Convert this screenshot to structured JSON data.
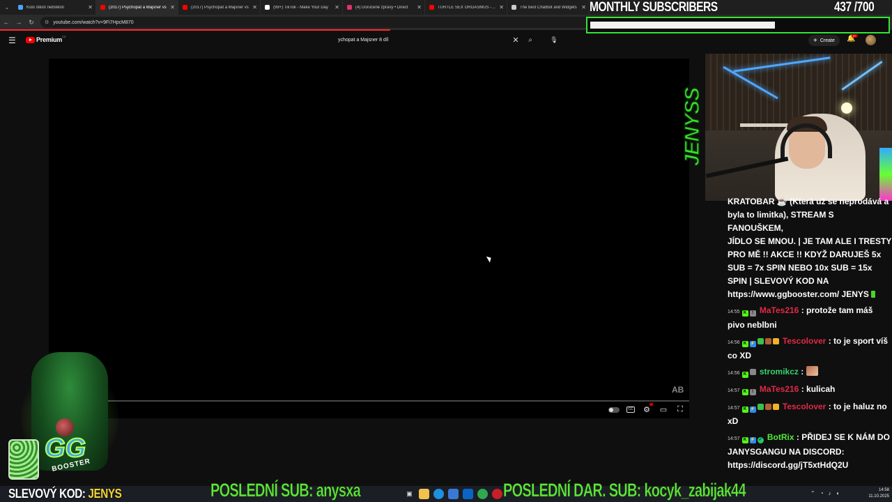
{
  "browser": {
    "tabs": [
      {
        "title": "Kolo štěstí nebštěstí",
        "favicon_color": "#4aa3ff",
        "active": false
      },
      {
        "title": "(2017) Psychopat a Majsner vs",
        "favicon_color": "#ff0000",
        "active": true
      },
      {
        "title": "(2017) Psychopat a Majsner vs",
        "favicon_color": "#ff0000",
        "active": false
      },
      {
        "title": "(99+) TikTok - Make Your Day",
        "favicon_color": "#ffffff",
        "active": false
      },
      {
        "title": "(4) Doručené zprávy • Direct",
        "favicon_color": "#e1306c",
        "active": false
      },
      {
        "title": "TURTLE SEX ORGASMUS - YouTube",
        "favicon_color": "#ff0000",
        "active": false
      },
      {
        "title": "The best ChatBot and Widgets",
        "favicon_color": "#cccccc",
        "active": false
      }
    ],
    "url": "youtube.com/watch?v=9Fi7HpcM870"
  },
  "youtube": {
    "logo_text": "Premium",
    "country_code": "CZ",
    "search_query": "ychopat a Majsner 8 díl",
    "create_label": "Create",
    "notification_count": "9+"
  },
  "player": {
    "watermark": "AB"
  },
  "overlay": {
    "monthly_title": "MONTHLY SUBSCRIBERS",
    "monthly_current": "437",
    "monthly_goal": "/700",
    "monthly_progress": 0.624,
    "streamer_name": "JENYSS",
    "discount_label": "SLEVOVÝ KOD:",
    "discount_code": "JENYS",
    "last_sub": "POSLEDNÍ SUB: anysxa",
    "last_gift_sub": "POSLEDNÍ DAR. SUB: kocyk_zabijak44",
    "gg_text": "GG",
    "booster_text": "BOOSTER"
  },
  "chat": {
    "header_lines": [
      "KRATOBAR ☕ (Která už se neprodává a",
      "byla to limitka), STREAM S FANOUŠKEM,",
      "JÍDLO SE MNOU. | JE TAM ALE I TRESTY",
      "PRO MĚ !! AKCE !! KDYŽ DARUJEŠ 5x",
      "SUB = 7x SPIN NEBO 10x SUB = 15x",
      "SPIN | SLEVOVÝ KOD NA",
      "https://www.ggbooster.com/ JENYS"
    ],
    "messages": [
      {
        "time": "14:55",
        "user": "MaTes216",
        "text": ": protože tam máš pivo neblbni",
        "color": "#e02a45"
      },
      {
        "time": "14:56",
        "user": "Tescolover",
        "text": ": to je sport víš co XD",
        "color": "#e02a45"
      },
      {
        "time": "14:56",
        "user": "stromikcz",
        "text": ":",
        "color": "#35d36e"
      },
      {
        "time": "14:57",
        "user": "MaTes216",
        "text": ": kulicah",
        "color": "#e02a45"
      },
      {
        "time": "14:57",
        "user": "Tescolover",
        "text": ": to je haluz no xD",
        "color": "#e02a45"
      },
      {
        "time": "14:57",
        "user": "BotRix",
        "text": ": PŘIDEJ SE K NÁM DO JANYSGANGU NA DISCORD: https://discord.gg/jT5xtHdQ2U",
        "color": "#53e93a"
      }
    ]
  },
  "taskbar": {
    "time": "14:58",
    "date": "11.10.2025"
  }
}
